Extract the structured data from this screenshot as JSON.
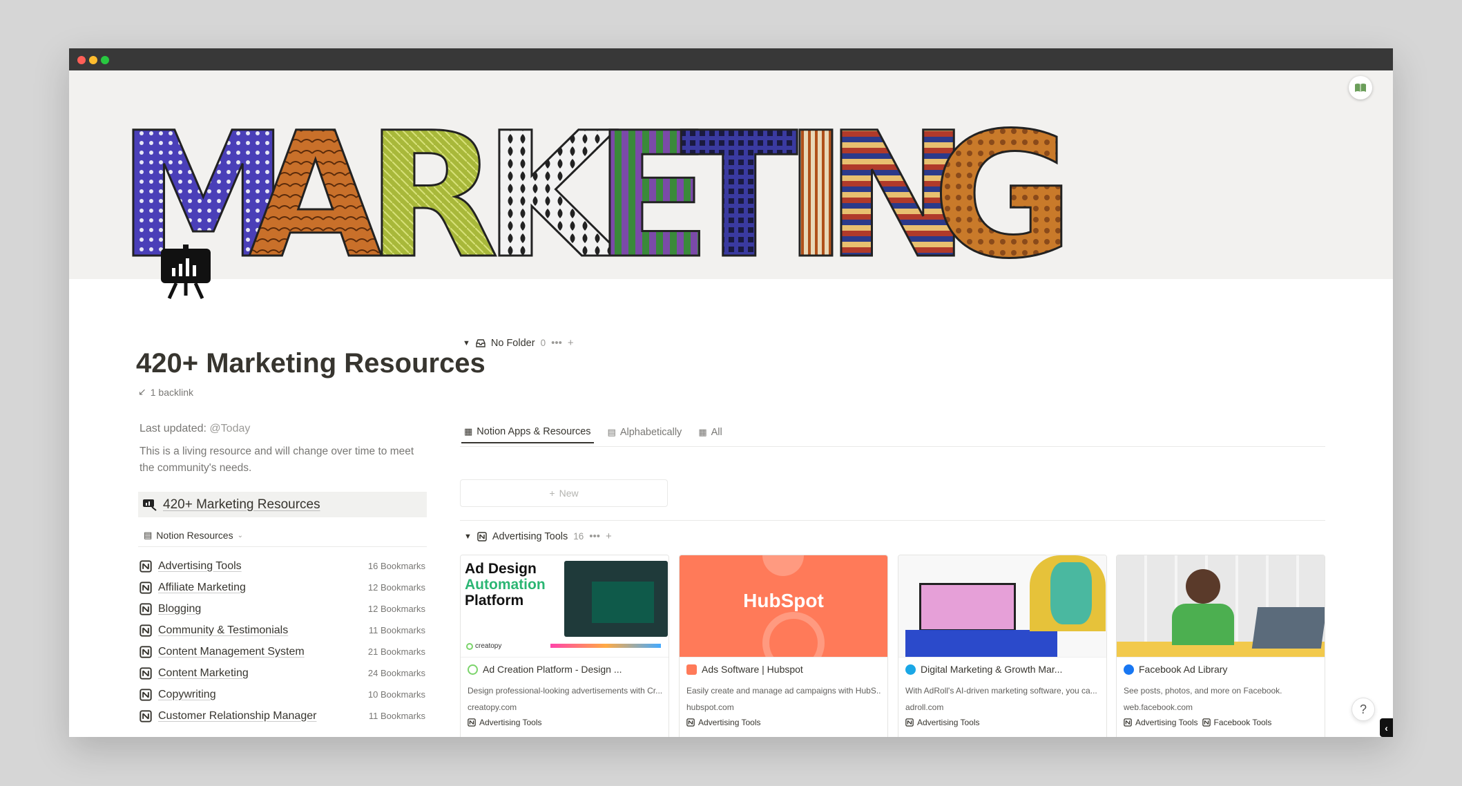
{
  "window": {
    "traffic_lights": [
      "#ff5f57",
      "#febc2e",
      "#28c840"
    ]
  },
  "cover": {
    "letters": [
      "M",
      "A",
      "R",
      "K",
      "E",
      "T",
      "I",
      "N",
      "G"
    ],
    "letter_colors": [
      "#4a3fb8",
      "#c9702a",
      "#b8c23a",
      "#2b2b2b",
      "#7b4aa8",
      "#3a3aa0",
      "#d99a3a",
      "#2b3a8a",
      "#c97a2a"
    ]
  },
  "page": {
    "title": "420+ Marketing Resources",
    "backlink": "1 backlink",
    "last_updated_label": "Last updated:",
    "last_updated_value": "@Today",
    "description": "This is a living resource and will change over time to meet the community's needs.",
    "callout_text": "420+ Marketing Resources",
    "notion_resources_label": "Notion Resources"
  },
  "left_list": [
    {
      "name": "Advertising Tools",
      "count": "16 Bookmarks"
    },
    {
      "name": "Affiliate Marketing",
      "count": "12 Bookmarks"
    },
    {
      "name": "Blogging",
      "count": "12 Bookmarks"
    },
    {
      "name": "Community & Testimonials",
      "count": "11 Bookmarks"
    },
    {
      "name": "Content Management System",
      "count": "21 Bookmarks"
    },
    {
      "name": "Content Marketing",
      "count": "24 Bookmarks"
    },
    {
      "name": "Copywriting",
      "count": "10 Bookmarks"
    },
    {
      "name": "Customer Relationship Manager",
      "count": "11 Bookmarks"
    }
  ],
  "tabs": [
    {
      "label": "Notion Apps & Resources",
      "active": true
    },
    {
      "label": "Alphabetically",
      "active": false
    },
    {
      "label": "All",
      "active": false
    }
  ],
  "groups": {
    "no_folder": {
      "label": "No Folder",
      "count": "0",
      "more": "•••",
      "add": "+"
    },
    "new_label": "New",
    "advertising": {
      "label": "Advertising Tools",
      "count": "16",
      "more": "•••",
      "add": "+"
    }
  },
  "cards": [
    {
      "preview_text": [
        "Ad Design",
        "Automation",
        "Platform"
      ],
      "preview_brand": "creatopy",
      "title": "Ad Creation Platform - Design ...",
      "desc": "Design professional-looking advertisements with Cr...",
      "url": "creatopy.com",
      "tags": [
        "Advertising Tools"
      ],
      "favicon_color": "#7bd46b"
    },
    {
      "preview_text": [
        "HubSpot"
      ],
      "title": "Ads Software | Hubspot",
      "desc": "Easily create and manage ad campaigns with HubS...",
      "url": "hubspot.com",
      "tags": [
        "Advertising Tools"
      ],
      "favicon_color": "#ff7a59"
    },
    {
      "preview_text": [],
      "title": "Digital Marketing & Growth Mar...",
      "desc": "With AdRoll's AI-driven marketing software, you ca...",
      "url": "adroll.com",
      "tags": [
        "Advertising Tools"
      ],
      "favicon_color": "#1aa7e6"
    },
    {
      "preview_text": [],
      "title": "Facebook Ad Library",
      "desc": "See posts, photos, and more on Facebook.",
      "url": "web.facebook.com",
      "tags": [
        "Advertising Tools",
        "Facebook Tools"
      ],
      "favicon_color": "#1877f2"
    }
  ],
  "help_label": "?",
  "side_tab_label": "‹"
}
